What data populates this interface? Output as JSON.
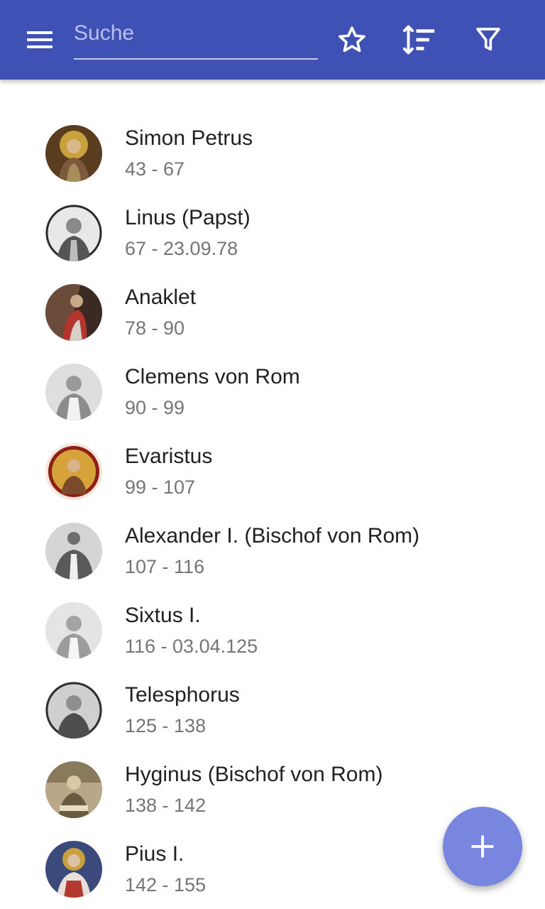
{
  "toolbar": {
    "background": "#3f51b5",
    "menu_icon": "menu-icon",
    "search_placeholder": "Suche",
    "search_value": "",
    "actions": [
      {
        "name": "favorites-button",
        "icon": "star-outline-icon"
      },
      {
        "name": "sort-button",
        "icon": "sort-icon"
      },
      {
        "name": "filter-button",
        "icon": "filter-icon"
      }
    ]
  },
  "popes": [
    {
      "name": "Simon Petrus",
      "dates": "43 - 67"
    },
    {
      "name": "Linus (Papst)",
      "dates": "67 - 23.09.78"
    },
    {
      "name": "Anaklet",
      "dates": "78 - 90"
    },
    {
      "name": "Clemens von Rom",
      "dates": "90 - 99"
    },
    {
      "name": "Evaristus",
      "dates": "99 - 107"
    },
    {
      "name": "Alexander I. (Bischof von Rom)",
      "dates": "107 - 116"
    },
    {
      "name": "Sixtus I.",
      "dates": "116 - 03.04.125"
    },
    {
      "name": "Telesphorus",
      "dates": "125 - 138"
    },
    {
      "name": "Hyginus (Bischof von Rom)",
      "dates": "138 - 142"
    },
    {
      "name": "Pius I.",
      "dates": "142 - 155"
    }
  ],
  "fab": {
    "icon": "add-icon",
    "color": "#7986e0"
  }
}
